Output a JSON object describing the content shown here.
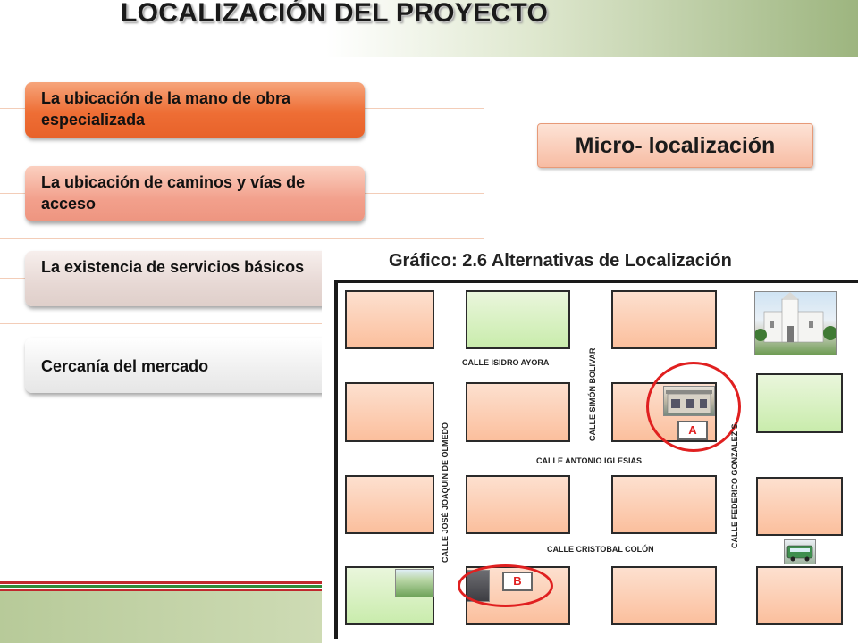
{
  "header": {
    "title": "LOCALIZACIÓN DEL PROYECTO"
  },
  "factors": [
    {
      "label": "La ubicación de la mano de obra especializada"
    },
    {
      "label": "La ubicación de caminos y vías de acceso"
    },
    {
      "label": "La existencia de servicios básicos"
    },
    {
      "label": "Cercanía del mercado"
    }
  ],
  "micro": {
    "label": "Micro- localización"
  },
  "map": {
    "title": "Gráfico: 2.6 Alternativas de Localización",
    "streets": {
      "isidro": "CALLE ISIDRO AYORA",
      "simon": "CALLE SIMÓN BOLIVAR",
      "antonio": "CALLE ANTONIO IGLESIAS",
      "olmedo": "CALLE JOSÉ JOAQUIN DE OLMEDO",
      "cristobal": "CALLE CRISTOBAL COLÓN",
      "federico": "CALLE FEDERICO GONZALEZ S."
    },
    "markers": {
      "a": "A",
      "b": "B"
    }
  },
  "colors": {
    "accent_orange": "#ee6e35",
    "footer_green": "#b7ca99",
    "stripe_red": "#c0282d",
    "stripe_green": "#2e8b3a",
    "marker_red": "#e02020"
  }
}
